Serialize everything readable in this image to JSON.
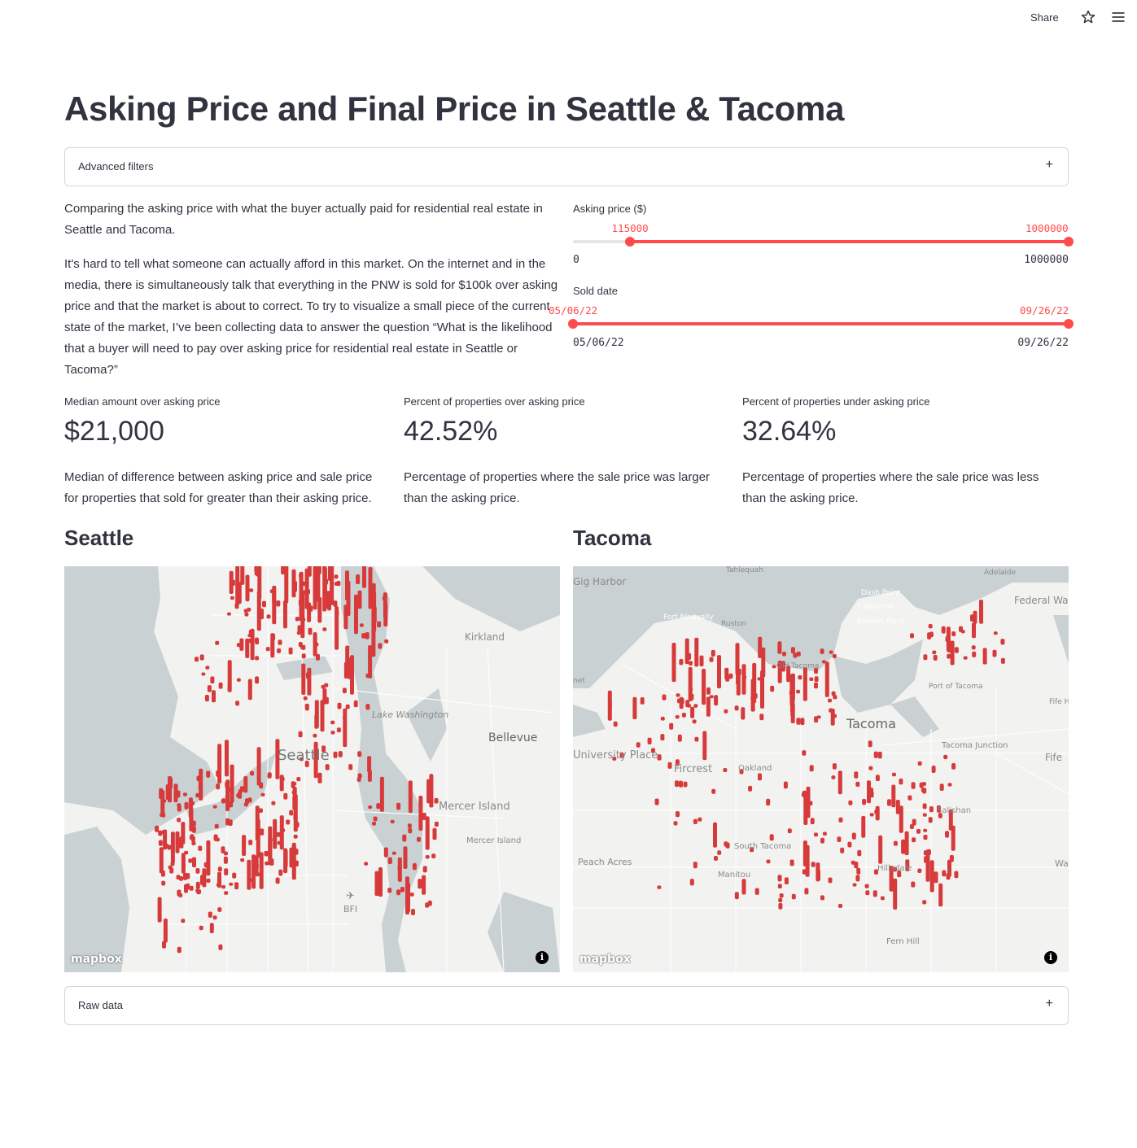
{
  "toolbar": {
    "share_label": "Share",
    "star_icon": "star-icon",
    "menu_icon": "hamburger-menu-icon"
  },
  "page": {
    "title": "Asking Price and Final Price in Seattle & Tacoma"
  },
  "advanced_filters": {
    "label": "Advanced filters",
    "toggle": "+"
  },
  "intro": {
    "p1": "Comparing the asking price with what the buyer actually paid for residential real estate in Seattle and Tacoma.",
    "p2": "It's hard to tell what someone can actually afford in this market. On the internet and in the media, there is simultaneously talk that everything in the PNW is sold for $100k over asking price and that the market is about to correct. To try to visualize a small piece of the current state of the market, I’ve been collecting data to answer the question “What is the likelihood that a buyer will need to pay over asking price for residential real estate in Seattle or Tacoma?”"
  },
  "sliders": {
    "asking_price": {
      "label": "Asking price ($)",
      "min_label": "0",
      "max_label": "1000000",
      "low_value": "115000",
      "high_value": "1000000",
      "low_fraction": 0.115,
      "high_fraction": 1.0
    },
    "sold_date": {
      "label": "Sold date",
      "min_label": "05/06/22",
      "max_label": "09/26/22",
      "low_value": "05/06/22",
      "high_value": "09/26/22",
      "low_fraction": 0.0,
      "high_fraction": 1.0
    }
  },
  "metrics": [
    {
      "label": "Median amount over asking price",
      "value": "$21,000",
      "description": "Median of difference between asking price and sale price for properties that sold for greater than their asking price."
    },
    {
      "label": "Percent of properties over asking price",
      "value": "42.52%",
      "description": "Percentage of properties where the sale price was larger than the asking price."
    },
    {
      "label": "Percent of properties under asking price",
      "value": "32.64%",
      "description": "Percentage of properties where the sale price was less than the asking price."
    }
  ],
  "maps": {
    "seattle": {
      "heading": "Seattle",
      "labels": [
        "Kirkland",
        "Lake Washington",
        "Seattle",
        "Bellevue",
        "Mercer Island",
        "Mercer Island",
        "BFI"
      ],
      "attribution": "mapbox",
      "info": "i"
    },
    "tacoma": {
      "heading": "Tacoma",
      "labels": [
        "Tahlequah",
        "Adelaide",
        "Gig Harbor",
        "Federal Wa",
        "Dash Point",
        "Caledonia",
        "Browns Point",
        "Fort Nisqually",
        "Ruston",
        "Old Tacoma",
        "Port of Tacoma",
        "Fife H",
        "Tacoma",
        "Tacoma Junction",
        "Fife",
        "University Place",
        "Fircrest",
        "Oakland",
        "Salishan",
        "South Tacoma",
        "Peach Acres",
        "Manitou",
        "Hillsdale",
        "Wa",
        "Fern Hill",
        "net"
      ],
      "attribution": "mapbox",
      "info": "i"
    }
  },
  "raw_data": {
    "label": "Raw data",
    "toggle": "+"
  },
  "colors": {
    "accent": "#ff4b4b",
    "text": "#31333f",
    "bar": "#d63a3a",
    "water": "#c9d1d3",
    "land": "#f2f2f0"
  }
}
